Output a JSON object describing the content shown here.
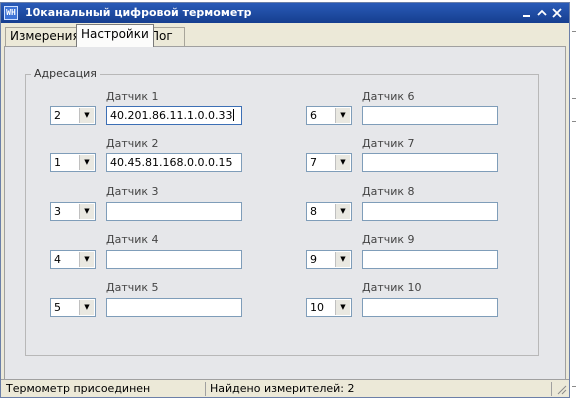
{
  "window": {
    "title": "10канальный цифровой термометр",
    "icon_text": "WH"
  },
  "tabs": [
    {
      "label": "Измерения",
      "active": false
    },
    {
      "label": "Настройки",
      "active": true
    },
    {
      "label": "Лог",
      "active": false
    }
  ],
  "group": {
    "label": "Адресация"
  },
  "sensors": [
    {
      "label": "Датчик 1",
      "index": "2",
      "address": "40.201.86.11.1.0.0.33"
    },
    {
      "label": "Датчик 2",
      "index": "1",
      "address": "40.45.81.168.0.0.0.15"
    },
    {
      "label": "Датчик 3",
      "index": "3",
      "address": ""
    },
    {
      "label": "Датчик 4",
      "index": "4",
      "address": ""
    },
    {
      "label": "Датчик 5",
      "index": "5",
      "address": ""
    },
    {
      "label": "Датчик 6",
      "index": "6",
      "address": ""
    },
    {
      "label": "Датчик 7",
      "index": "7",
      "address": ""
    },
    {
      "label": "Датчик 8",
      "index": "8",
      "address": ""
    },
    {
      "label": "Датчик 9",
      "index": "9",
      "address": ""
    },
    {
      "label": "Датчик 10",
      "index": "10",
      "address": ""
    }
  ],
  "status": {
    "connection": "Термометр присоединен",
    "found": "Найдено измерителей: 2"
  },
  "icons": {
    "dropdown": "dropdown-arrow-icon",
    "minimize": "minimize-icon",
    "maximize": "maximize-icon",
    "close": "close-icon",
    "grip": "resize-grip-icon"
  }
}
